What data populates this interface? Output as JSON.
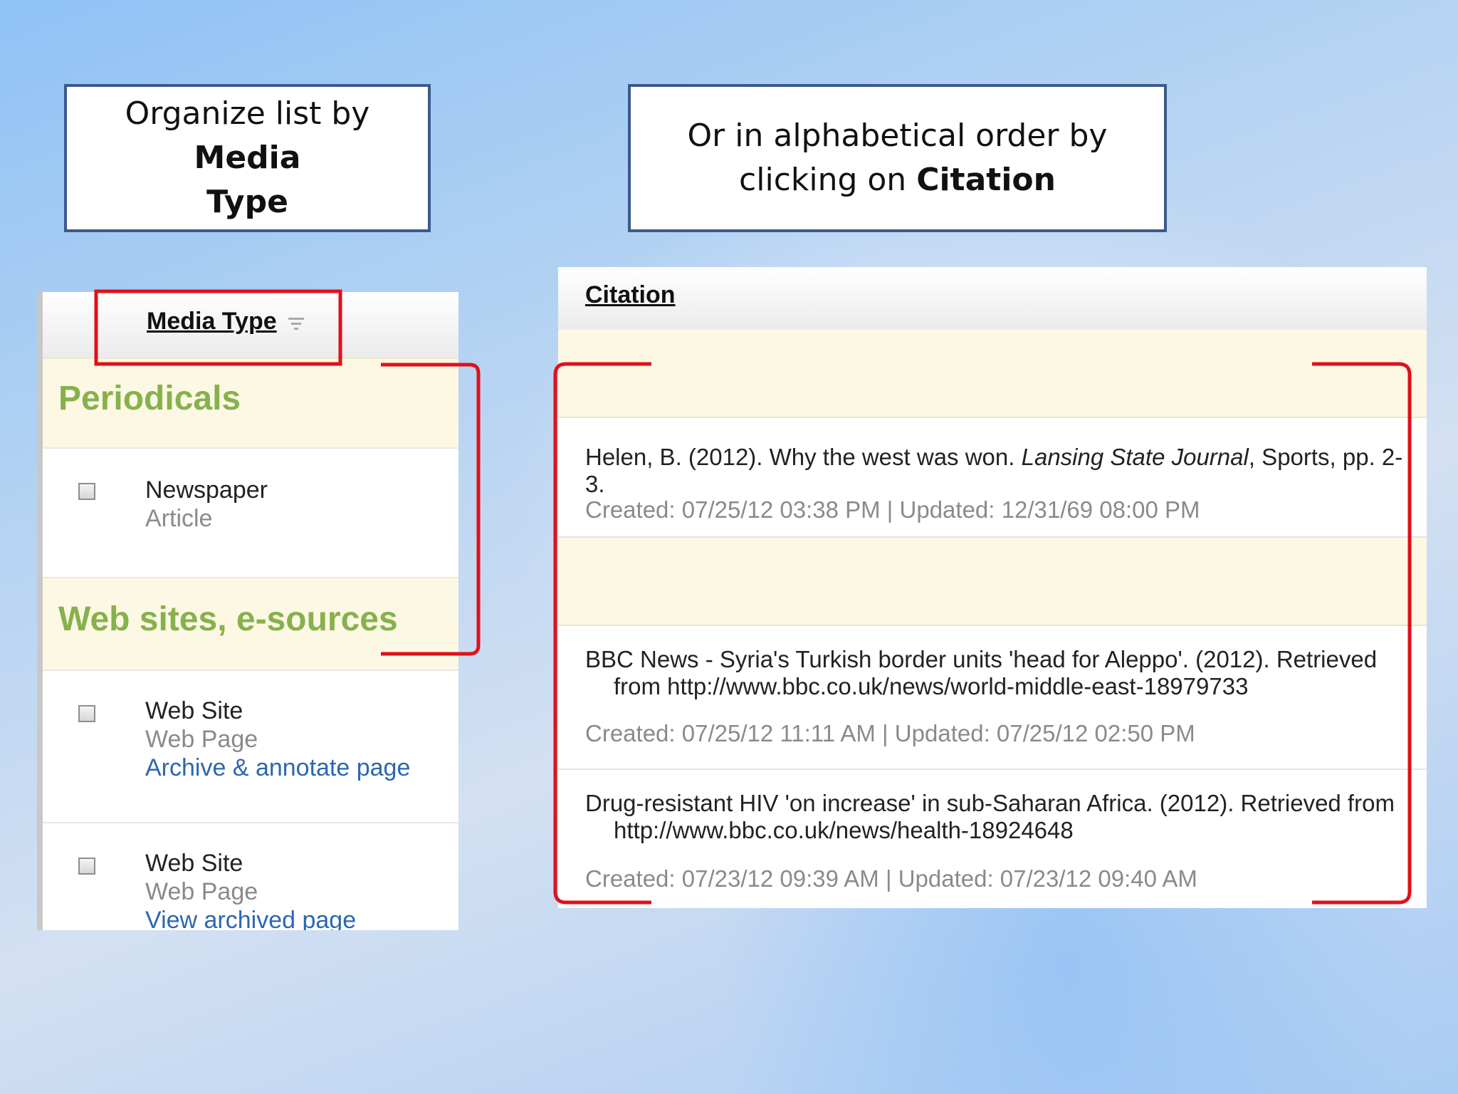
{
  "callouts": {
    "left": {
      "text": "Organize list by ",
      "bold1": "Media",
      "bold2": "Type"
    },
    "right": {
      "line1": "Or in alphabetical order by",
      "line2": "clicking on ",
      "bold": "Citation"
    }
  },
  "left_panel": {
    "header": "Media Type",
    "sort_icon": "sort-descending-icon",
    "groups": [
      {
        "title": "Periodicals",
        "items": [
          {
            "type": "Newspaper",
            "subtype": "Article"
          }
        ]
      },
      {
        "title": "Web sites, e-sources",
        "items": [
          {
            "type": "Web Site",
            "subtype": "Web Page",
            "link": "Archive & annotate page"
          },
          {
            "type": "Web Site",
            "subtype": "Web Page",
            "link": "View archived page"
          }
        ]
      }
    ]
  },
  "right_panel": {
    "header": "Citation",
    "rows": [
      {
        "pre": "Helen, B. (2012). Why the west was won. ",
        "italic": "Lansing State Journal",
        "post": ", Sports, pp. 2-3.",
        "meta": "Created: 07/25/12 03:38 PM | Updated: 12/31/69 08:00 PM"
      },
      {
        "line1": "BBC News - Syria's Turkish border units 'head for Aleppo'. (2012). Retrieved",
        "line2": "from http://www.bbc.co.uk/news/world-middle-east-18979733",
        "meta": "Created: 07/25/12 11:11 AM | Updated: 07/25/12 02:50 PM"
      },
      {
        "line1": "Drug-resistant HIV 'on increase' in sub-Saharan Africa. (2012). Retrieved from",
        "line2": "http://www.bbc.co.uk/news/health-18924648",
        "meta": "Created: 07/23/12 09:39 AM | Updated: 07/23/12 09:40 AM"
      }
    ]
  },
  "colors": {
    "accent_red": "#e0101a",
    "group_green": "#86b14c",
    "link_blue": "#2b67b0",
    "callout_border": "#3c5a8a"
  }
}
